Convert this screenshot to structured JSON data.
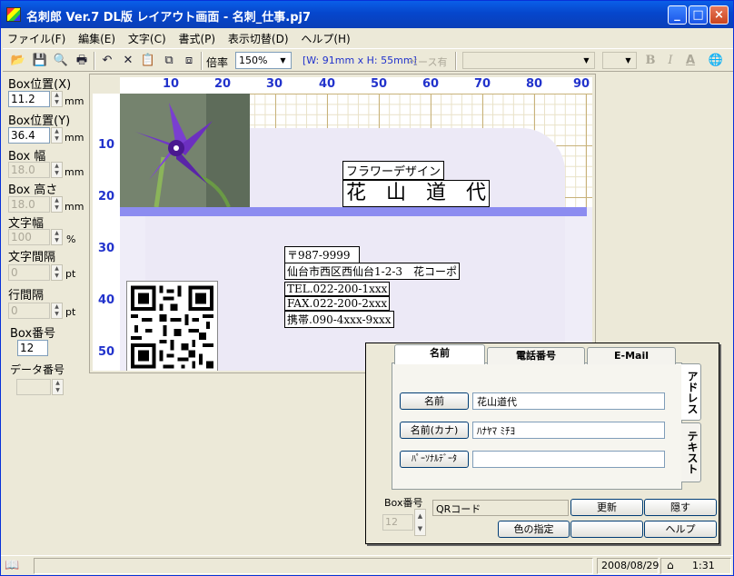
{
  "window": {
    "title": "名刺郎 Ver.7 DL版 レイアウト画面 - 名刺_仕事.pj7",
    "minimize": "_",
    "maximize": "□",
    "close": "×"
  },
  "menu": [
    "ファイル(F)",
    "編集(E)",
    "文字(C)",
    "書式(P)",
    "表示切替(D)",
    "ヘルプ(H)"
  ],
  "toolbar": {
    "icons": [
      "open-folder-icon",
      "save-icon",
      "print-preview-icon",
      "print-icon",
      "undo-icon",
      "delete-icon",
      "paste-icon",
      "copy-icon",
      "group-icon"
    ],
    "glyphs": [
      "📂",
      "💾",
      "🔍",
      "🖶",
      "↶",
      "✕",
      "📋",
      "⧉",
      "⧈"
    ],
    "zoom_label": "倍率",
    "zoom_value": "150%",
    "dimensions": "[W: 91mm x H: 55mm]",
    "base_label": "ベース有",
    "font_bold": "B",
    "font_italic": "I",
    "font_color": "A",
    "globe": "🌐"
  },
  "left": {
    "box_x_label": "Box位置(X)",
    "box_x_value": "11.2",
    "box_y_label": "Box位置(Y)",
    "box_y_value": "36.4",
    "box_w_label": "Box 幅",
    "box_w_value": "18.0",
    "box_h_label": "Box 高さ",
    "box_h_value": "18.0",
    "char_w_label": "文字幅",
    "char_w_value": "100",
    "char_sp_label": "文字間隔",
    "char_sp_value": "0",
    "line_sp_label": "行間隔",
    "line_sp_value": "0",
    "box_no_label": "Box番号",
    "box_no_value": "12",
    "data_no_label": "データ番号",
    "data_no_value": "",
    "unit_mm": "mm",
    "unit_pct": "%",
    "unit_pt": "pt"
  },
  "ruler": {
    "top": [
      "10",
      "20",
      "30",
      "40",
      "50",
      "60",
      "70",
      "80",
      "90"
    ],
    "left": [
      "10",
      "20",
      "30",
      "40",
      "50"
    ]
  },
  "card": {
    "company": "フラワーデザイン",
    "name": "花　山　道　代",
    "postal": "〒987-9999",
    "address": "仙台市西区西仙台1-2-3　花コーポ",
    "tel": "TEL.022-200-1xxx",
    "fax": "FAX.022-200-2xxx",
    "mobile": "携帯.090-4xxx-9xxx"
  },
  "dialog": {
    "tabs": [
      "名前",
      "電話番号",
      "E-Mail"
    ],
    "vtabs": [
      "アドレス",
      "テキスト"
    ],
    "fields": [
      {
        "button": "名前",
        "value": "花山道代"
      },
      {
        "button": "名前(カナ)",
        "value": "ﾊﾅﾔﾏ ﾐﾁﾖ"
      },
      {
        "button": "ﾊﾟｰｿﾅﾙﾃﾞｰﾀ",
        "value": ""
      }
    ],
    "box_no_label": "Box番号",
    "box_no_value": "12",
    "type_value": "QRコード",
    "update": "更新",
    "hide": "隠す",
    "color": "色の指定",
    "help": "ヘルプ"
  },
  "status": {
    "date": "2008/08/29",
    "time": "1:31"
  },
  "colors": {
    "title": "#0a5fe8",
    "ruler_num": "#2233cc",
    "band": "#8c8cf0",
    "card_bg": "#ece9f6"
  }
}
